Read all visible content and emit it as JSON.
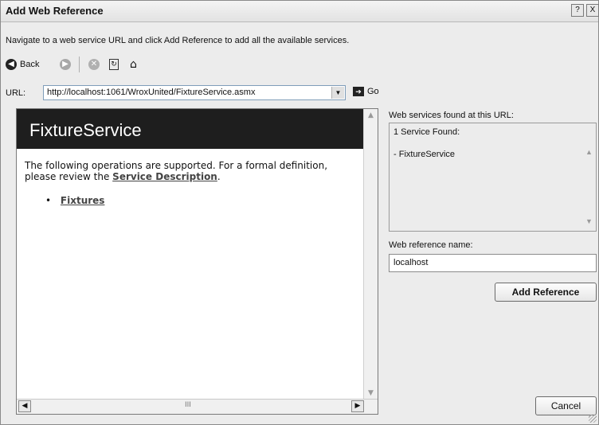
{
  "window": {
    "title": "Add Web Reference",
    "help_btn": "?",
    "close_btn": "X"
  },
  "instructions": "Navigate to a web service URL and click Add Reference to add all the available services.",
  "toolbar": {
    "back_label": "Back"
  },
  "url": {
    "label": "URL:",
    "value": "http://localhost:1061/WroxUnited/FixtureService.asmx",
    "go_label": "Go"
  },
  "browser": {
    "service_name": "FixtureService",
    "ops_text": "The following operations are supported. For a formal definition, please review the",
    "service_description_link": "Service Description",
    "ops_text_end": ".",
    "operations": [
      "Fixtures"
    ],
    "hscroll_grip": "III"
  },
  "results": {
    "label": "Web services found at this URL:",
    "count_text": "1 Service Found:",
    "items": [
      "- FixtureService"
    ]
  },
  "reference": {
    "label": "Web reference name:",
    "value": "localhost",
    "add_button": "Add Reference"
  },
  "cancel_button": "Cancel"
}
